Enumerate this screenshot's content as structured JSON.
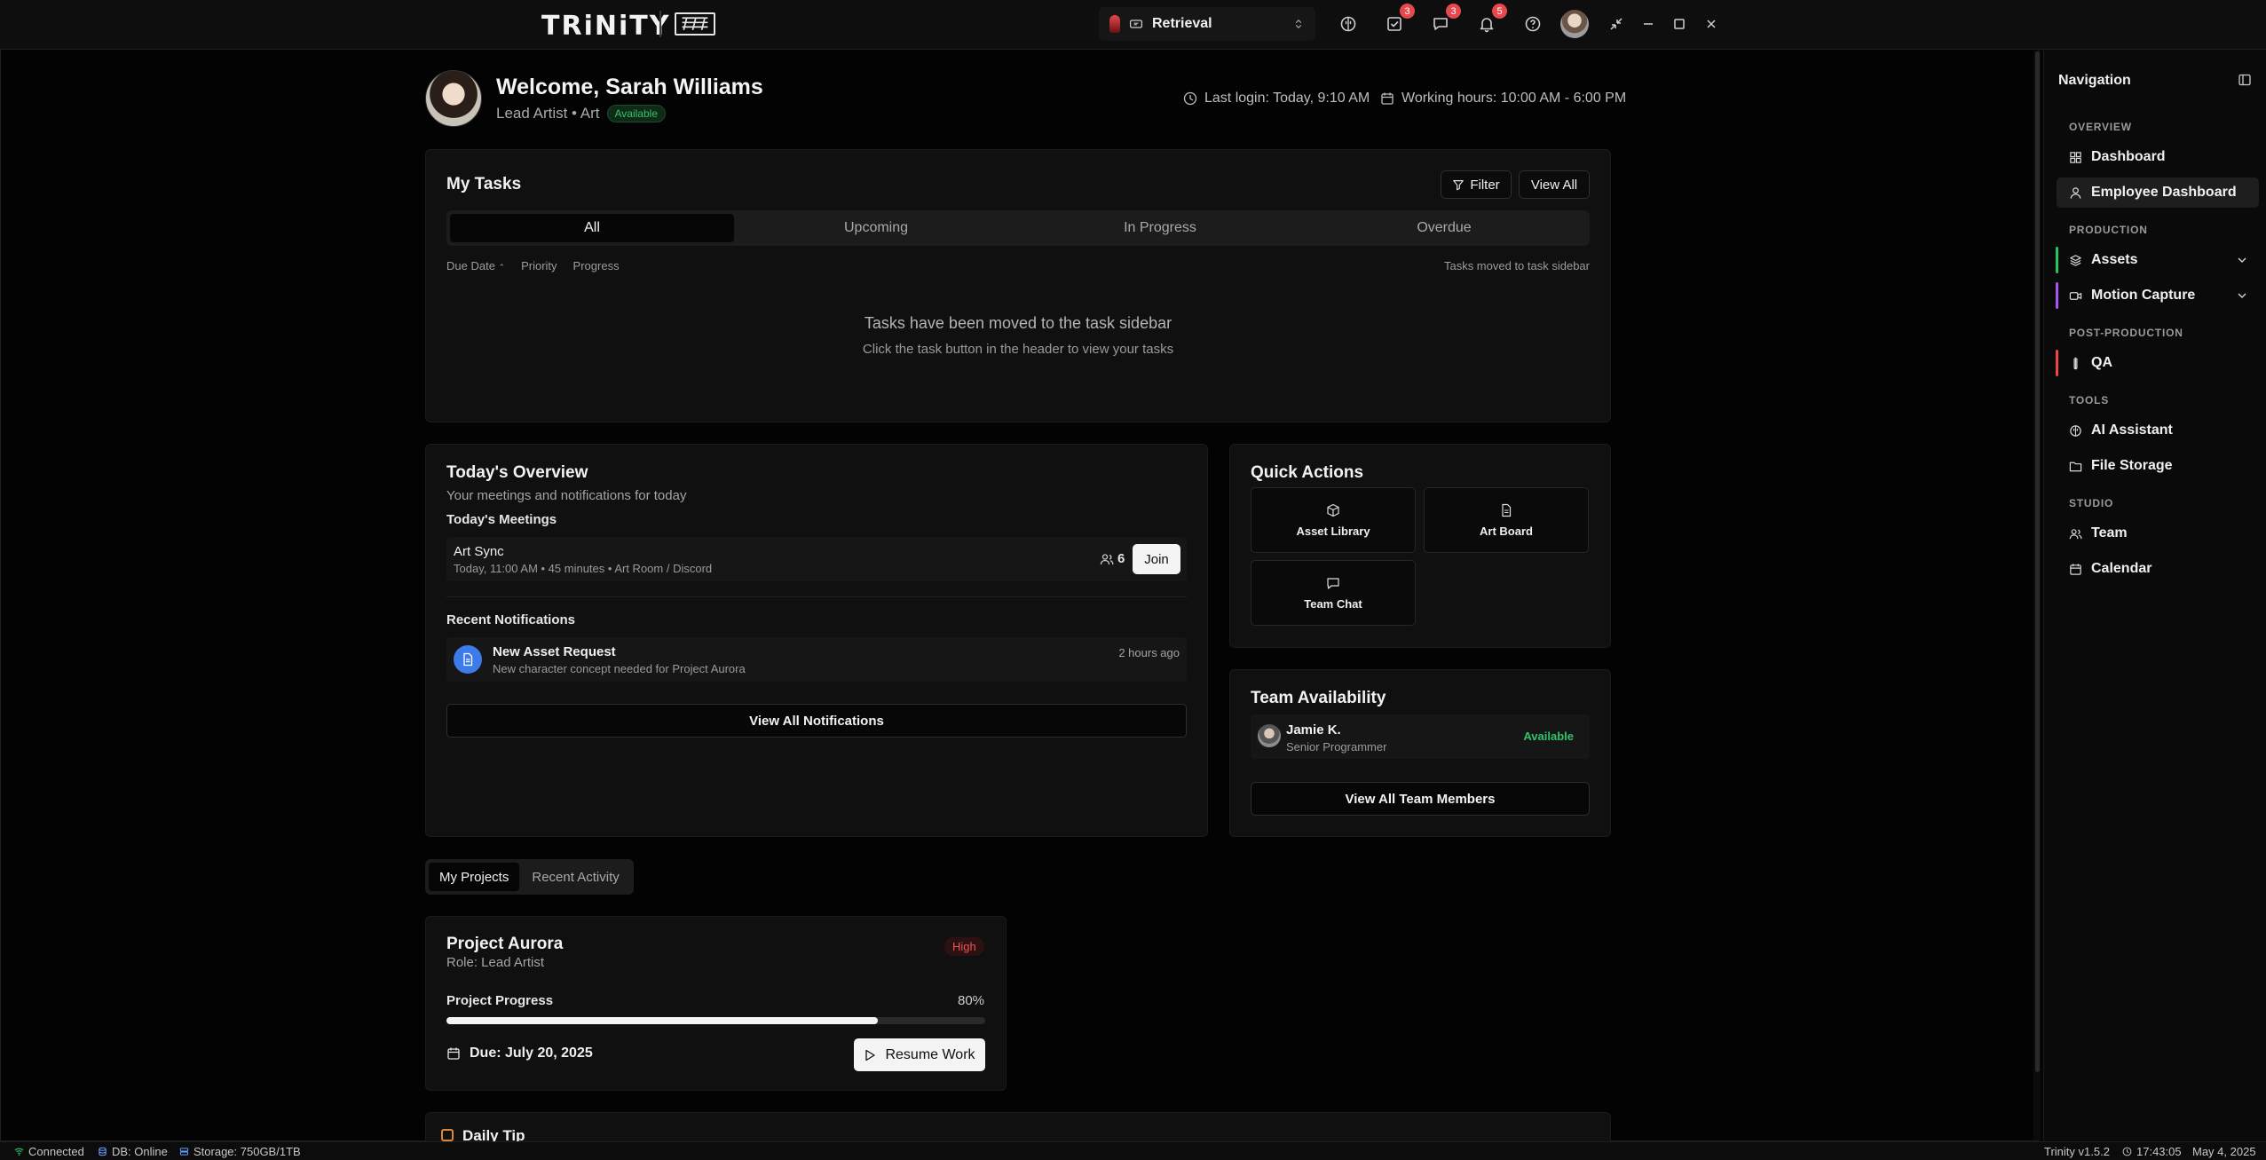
{
  "titlebar": {
    "logo": "TRiNiTY",
    "project_selector": {
      "value": "Retrieval"
    },
    "badges": {
      "tasks": "3",
      "messages": "3",
      "notifications": "5"
    }
  },
  "header": {
    "welcome": "Welcome, Sarah Williams",
    "role": "Lead Artist • Art",
    "status": "Available",
    "last_login": "Last login: Today, 9:10 AM",
    "working_hours": "Working hours: 10:00 AM - 6:00 PM"
  },
  "tasks": {
    "title": "My Tasks",
    "filter_label": "Filter",
    "view_all_label": "View All",
    "tabs": [
      "All",
      "Upcoming",
      "In Progress",
      "Overdue"
    ],
    "sort": {
      "due_date": "Due Date",
      "priority": "Priority",
      "progress": "Progress"
    },
    "note": "Tasks moved to task sidebar",
    "empty_title": "Tasks have been moved to the task sidebar",
    "empty_sub": "Click the task button in the header to view your tasks"
  },
  "overview": {
    "title": "Today's Overview",
    "subtitle": "Your meetings and notifications for today",
    "meetings_label": "Today's Meetings",
    "meeting": {
      "name": "Art Sync",
      "detail": "Today, 11:00 AM • 45 minutes • Art Room / Discord",
      "attendees": "6",
      "join_label": "Join"
    },
    "notifications_label": "Recent Notifications",
    "notification": {
      "title": "New Asset Request",
      "desc": "New character concept needed for Project Aurora",
      "time": "2 hours ago"
    },
    "view_all_label": "View All Notifications"
  },
  "quick_actions": {
    "title": "Quick Actions",
    "items": [
      "Asset Library",
      "Art Board",
      "Team Chat"
    ]
  },
  "team": {
    "title": "Team Availability",
    "member": {
      "name": "Jamie K.",
      "role": "Senior Programmer",
      "status": "Available"
    },
    "view_all_label": "View All Team Members"
  },
  "projects": {
    "tabs": [
      "My Projects",
      "Recent Activity"
    ],
    "card": {
      "name": "Project Aurora",
      "role": "Role: Lead Artist",
      "priority": "High",
      "progress_label": "Project Progress",
      "progress_text": "80%",
      "progress_value": 0.8,
      "due": "Due: July 20, 2025",
      "resume_label": "Resume Work"
    },
    "daily_tip_title": "Daily Tip"
  },
  "sidebar": {
    "title": "Navigation",
    "sections": {
      "overview": "OVERVIEW",
      "production": "PRODUCTION",
      "post_production": "POST-PRODUCTION",
      "tools": "TOOLS",
      "studio": "STUDIO"
    },
    "items": {
      "dashboard": "Dashboard",
      "employee_dashboard": "Employee Dashboard",
      "assets": "Assets",
      "motion_capture": "Motion Capture",
      "qa": "QA",
      "ai_assistant": "AI Assistant",
      "file_storage": "File Storage",
      "team": "Team",
      "calendar": "Calendar"
    },
    "accent_colors": {
      "assets": "#22c55e",
      "motion_capture": "#a855f7",
      "qa": "#ef4444"
    }
  },
  "statusbar": {
    "connected": "Connected",
    "db": "DB: Online",
    "storage": "Storage: 750GB/1TB",
    "version": "Trinity v1.5.2",
    "time": "17:43:05",
    "date": "May 4, 2025"
  }
}
